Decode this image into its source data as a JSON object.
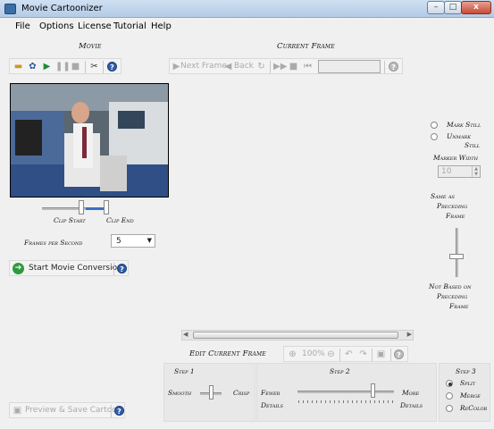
{
  "window": {
    "title": "Movie Cartoonizer",
    "min": "–",
    "max": "□",
    "close": "x"
  },
  "menu": [
    "File",
    "Options",
    "License",
    "Tutorial",
    "Help"
  ],
  "movie": {
    "title": "Movie",
    "clip_start": "Clip Start",
    "clip_end": "Clip End",
    "fps_label": "Frames per Second",
    "fps_value": "5",
    "start_label": "Start Movie Conversion",
    "preview_label": "Preview & Save Cartoon"
  },
  "current_frame": {
    "title": "Current Frame",
    "next_label": "Next Frame",
    "back_label": "Back",
    "mark_still": "Mark Still",
    "unmark_still_1": "Unmark",
    "unmark_still_2": "Still",
    "marker_width_label": "Marker Width",
    "marker_width_value": "10",
    "same_as_1": "Same as",
    "same_as_2": "Preceding",
    "same_as_3": "Frame",
    "not_based_1": "Not Based on",
    "not_based_2": "Preceding",
    "not_based_3": "Frame"
  },
  "edit": {
    "title": "Edit Current Frame",
    "zoom": "100%"
  },
  "steps": {
    "step1": {
      "title": "Step 1",
      "left": "Smooth",
      "right": "Crisp"
    },
    "step2": {
      "title": "Step 2",
      "left1": "Fewer",
      "left2": "Details",
      "right1": "More",
      "right2": "Details"
    },
    "step3": {
      "title": "Step 3",
      "options": [
        "Split",
        "Merge",
        "ReColor"
      ],
      "selected": "Split"
    }
  },
  "icons": {
    "help": "?",
    "open": "folder-icon",
    "record": "ribbon-icon",
    "play": "play-icon",
    "pause": "pause-icon",
    "stop": "stop-icon",
    "cut": "scissors-icon"
  }
}
